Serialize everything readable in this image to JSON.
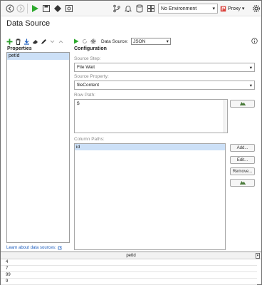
{
  "toolbar": {
    "environment": "No Environment",
    "proxy_label": "Proxy"
  },
  "page": {
    "title": "Data Source"
  },
  "properties": {
    "heading": "Properties",
    "items": [
      "petId"
    ],
    "learn_link": "Learn about data sources:"
  },
  "configuration": {
    "heading": "Configuration",
    "data_source_label": "Data Source:",
    "data_source_value": "JSON",
    "source_step_label": "Source Step:",
    "source_step_value": "File Wait",
    "source_property_label": "Source Property:",
    "source_property_value": "fileContent",
    "row_path_label": "Row Path:",
    "row_path_value": "$",
    "column_paths_label": "Column Paths:",
    "column_paths": [
      "id"
    ],
    "buttons": {
      "add": "Add...",
      "edit": "Edit...",
      "remove": "Remove..."
    }
  },
  "grid": {
    "header": "petId",
    "rows": [
      "4",
      "7",
      "99",
      "9"
    ]
  }
}
